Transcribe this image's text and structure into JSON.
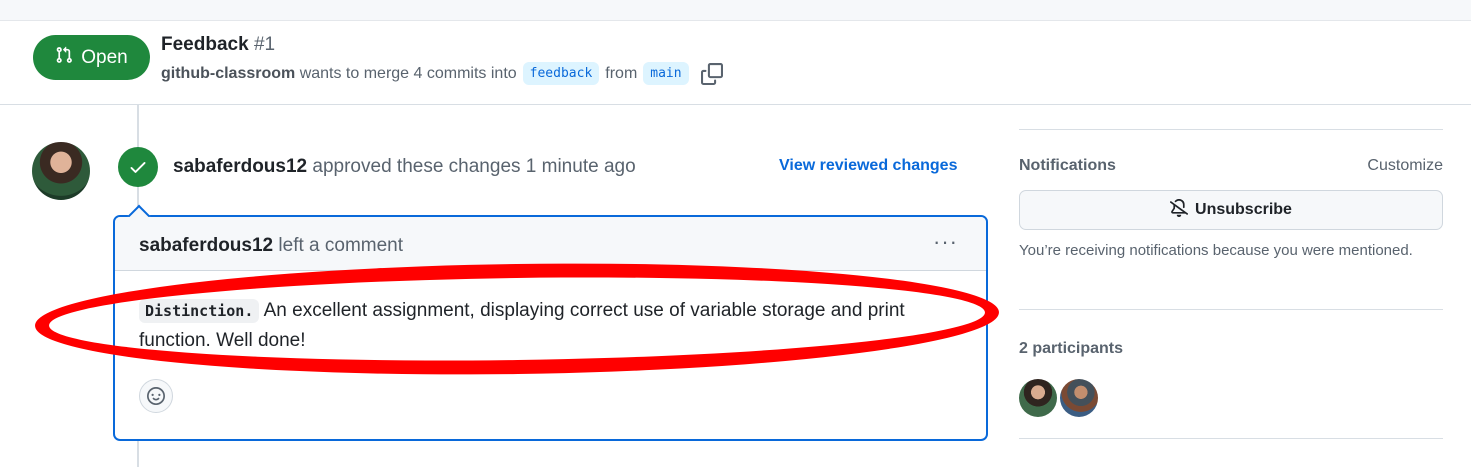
{
  "pr": {
    "state_label": "Open",
    "title": "Feedback",
    "number": "#1",
    "author": "github-classroom",
    "merge_text": "wants to merge 4 commits into",
    "base_branch": "feedback",
    "from_text": "from",
    "head_branch": "main"
  },
  "review": {
    "reviewer": "sabaferdous12",
    "action_text": "approved these changes 1 minute ago",
    "view_changes_label": "View reviewed changes"
  },
  "comment": {
    "author": "sabaferdous12",
    "action": "left a comment",
    "menu_label": "···",
    "code_text": "Distinction.",
    "body_text": " An excellent assignment, displaying correct use of variable storage and print function. Well done!"
  },
  "sidebar": {
    "notifications_title": "Notifications",
    "customize_label": "Customize",
    "unsubscribe_label": "Unsubscribe",
    "notification_reason": "You’re receiving notifications because you were mentioned.",
    "participants_title": "2 participants"
  },
  "colors": {
    "open_green": "#1f883d",
    "link_blue": "#0969da",
    "highlight_red": "#ff0000"
  },
  "icons": [
    "git-pull-request-icon",
    "copy-icon",
    "check-icon",
    "kebab-horizontal-icon",
    "smiley-icon",
    "bell-slash-icon"
  ]
}
